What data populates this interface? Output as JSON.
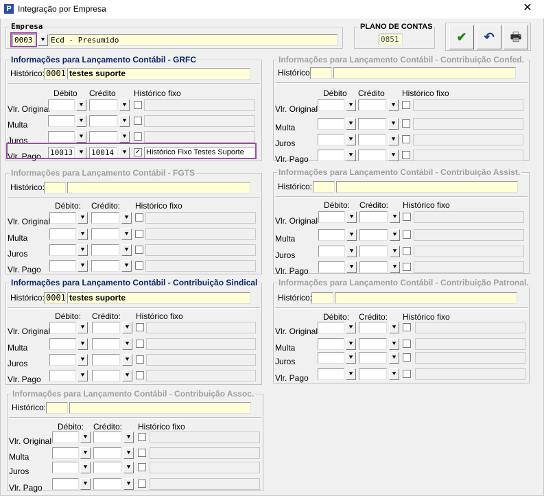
{
  "window": {
    "title": "Integração por Empresa",
    "app_icon": "P"
  },
  "empresa": {
    "label": "Empresa",
    "code": "0003",
    "name": "Ecd - Presumido"
  },
  "plano": {
    "label": "PLANO DE CONTAS",
    "value": "0851"
  },
  "toolbar": {
    "confirm": "✔",
    "undo": "↶",
    "print": "🖶"
  },
  "columns": {
    "debito": "Débito",
    "credito": "Crédito",
    "hist_fixo": "Histórico fixo",
    "debito_colon": "Débito:",
    "credito_colon": "Crédito:"
  },
  "row_labels": {
    "vlr_original": "Vlr. Original",
    "multa": "Multa",
    "juros": "Juros",
    "vlr_pago": "Vlr. Pago"
  },
  "historico_label": "Histórico:",
  "sections": {
    "grfc": {
      "title": "Informações para Lançamento Contábil - GRFC",
      "hist_code": "0001",
      "hist_text": "testes suporte",
      "pago_debito": "10013",
      "pago_credito": "10014",
      "pago_hist_fixo": "Histórico Fixo Testes Suporte",
      "pago_checked": "✓"
    },
    "fgts": {
      "title": "Informações para Lançamento Contábil - FGTS"
    },
    "sindical": {
      "title": "Informações para Lançamento Contábil - Contribuição Sindical",
      "hist_code": "0001",
      "hist_text": "testes suporte"
    },
    "assoc": {
      "title": "Informações para Lançamento Contábil - Contribuição Assoc."
    },
    "confed": {
      "title": "Informações para Lançamento Contábil - Contribuição Confed."
    },
    "assist": {
      "title": "Informações para Lançamento Contábil - Contribuição Assist."
    },
    "patronal": {
      "title": "Informações para Lançamento Contábil - Contribuição Patronal."
    }
  }
}
